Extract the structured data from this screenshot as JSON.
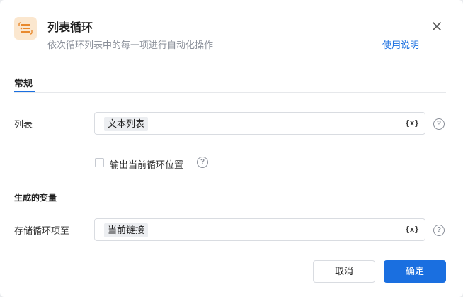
{
  "header": {
    "title": "列表循环",
    "subtitle": "依次循环列表中的每一项进行自动化操作",
    "help_link": "使用说明",
    "icon": "list-loop-icon",
    "accent_color": "#1a6fe0",
    "icon_bg_color": "#fbe7cf"
  },
  "tabs": [
    {
      "label": "常规",
      "active": true
    }
  ],
  "form": {
    "list": {
      "label": "列表",
      "tag": "文本列表",
      "var_button": "{x}",
      "help": "?"
    },
    "output_index": {
      "label": "输出当前循环位置",
      "checked": false,
      "help": "?"
    },
    "section_title": "生成的变量",
    "store": {
      "label": "存储循环项至",
      "tag": "当前链接",
      "var_button": "{x}",
      "help": "?"
    }
  },
  "footer": {
    "cancel_label": "取消",
    "ok_label": "确定"
  }
}
